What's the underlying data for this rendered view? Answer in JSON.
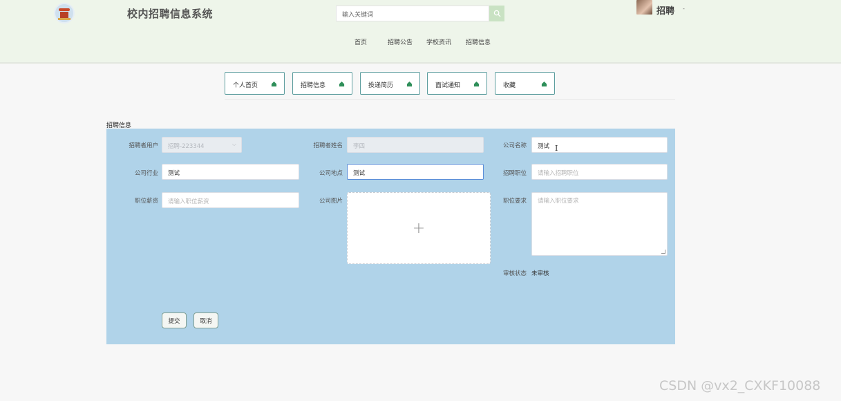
{
  "header": {
    "site_title": "校内招聘信息系统",
    "search_placeholder": "输入关键词",
    "search_icon": "search-icon",
    "user_name": "招聘",
    "user_caret": "-"
  },
  "nav": [
    "首页",
    "招聘公告",
    "学校资讯",
    "招聘信息"
  ],
  "tabs": [
    {
      "label": "个人首页",
      "icon": "home-icon"
    },
    {
      "label": "招聘信息",
      "icon": "home-icon"
    },
    {
      "label": "投递简历",
      "icon": "home-icon"
    },
    {
      "label": "面试通知",
      "icon": "home-icon"
    },
    {
      "label": "收藏",
      "icon": "home-icon"
    }
  ],
  "section_title": "招聘信息",
  "form": {
    "recruiter_user_label": "招聘者用户",
    "recruiter_user_value": "招聘-223344",
    "recruiter_name_label": "招聘者姓名",
    "recruiter_name_value": "李四",
    "company_name_label": "公司名称",
    "company_name_value": "测试",
    "industry_label": "公司行业",
    "industry_value": "测试",
    "location_label": "公司地点",
    "location_value": "测试",
    "position_label": "招聘职位",
    "position_placeholder": "请输入招聘职位",
    "salary_label": "职位薪资",
    "salary_placeholder": "请输入职位薪资",
    "picture_label": "公司图片",
    "upload_plus": "+",
    "requirement_label": "职位要求",
    "requirement_placeholder": "请输入职位要求",
    "status_label": "审核状态",
    "status_value": "未审核",
    "submit_label": "提交",
    "cancel_label": "取消"
  },
  "watermark": "CSDN @vx2_CXKF10088",
  "colors": {
    "header_bg": "#eef5ea",
    "panel_bg": "#b0d3e9",
    "tab_border": "#5c9d9e",
    "search_button": "#c9e2c3"
  }
}
